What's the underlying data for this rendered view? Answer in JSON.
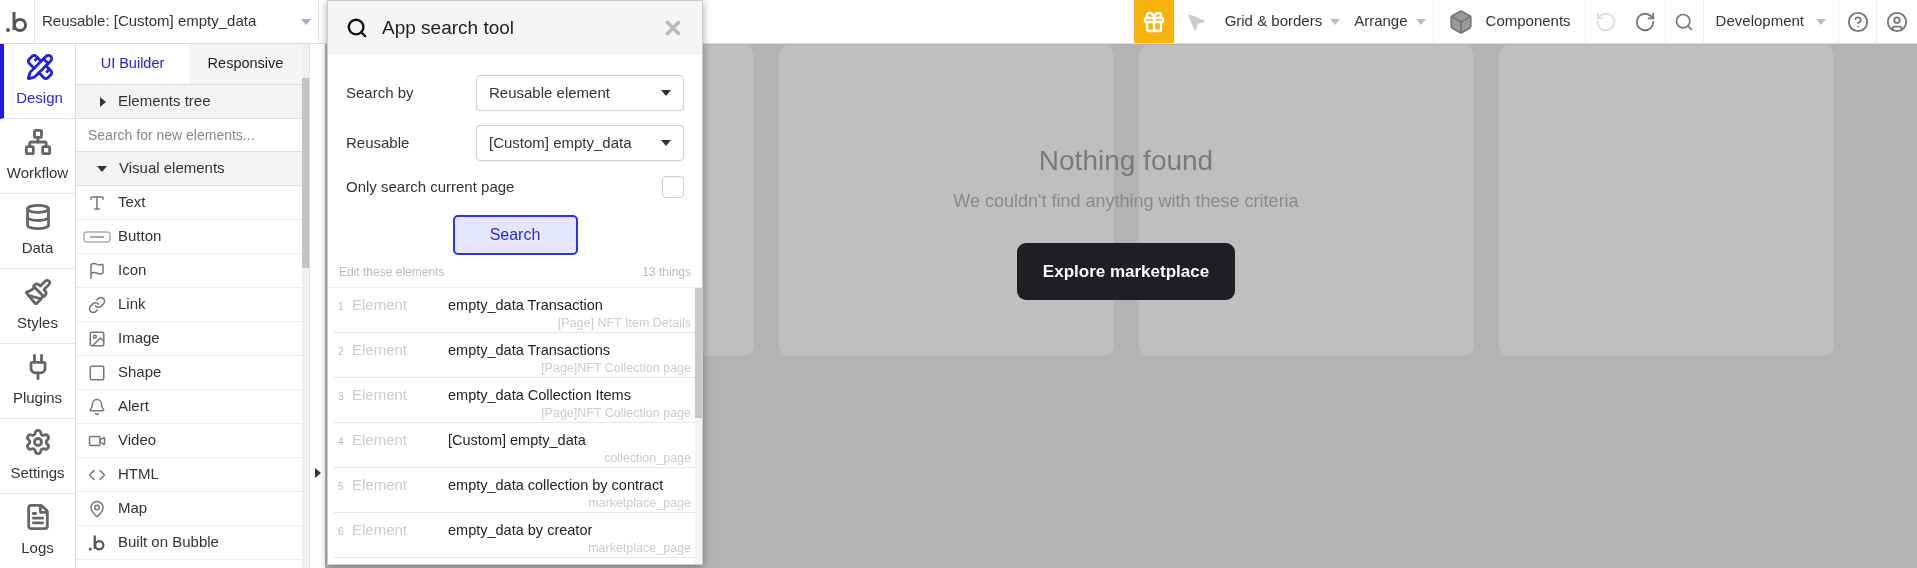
{
  "top_bar": {
    "page_selector": "Reusable: [Custom] empty_data",
    "menus": [
      {
        "label": "Grid & borders"
      },
      {
        "label": "Arrange"
      }
    ],
    "components": "Components",
    "undo": {
      "disabled": true
    },
    "redo": {
      "disabled": false
    },
    "environment": "Development"
  },
  "sidebar": {
    "items": [
      {
        "label": "Design",
        "kind": "design",
        "selected": true
      },
      {
        "label": "Workflow",
        "kind": "workflow",
        "selected": false
      },
      {
        "label": "Data",
        "kind": "data",
        "selected": false
      },
      {
        "label": "Styles",
        "kind": "styles",
        "selected": false
      },
      {
        "label": "Plugins",
        "kind": "plugins",
        "selected": false
      },
      {
        "label": "Settings",
        "kind": "settings",
        "selected": false
      },
      {
        "label": "Logs",
        "kind": "logs",
        "selected": false
      }
    ]
  },
  "panel": {
    "tabs": [
      {
        "label": "UI Builder",
        "selected": true
      },
      {
        "label": "Responsive",
        "selected": false
      }
    ],
    "elements_tree": {
      "label": "Elements tree",
      "expanded": false
    },
    "search": {
      "placeholder": "Search for new elements..."
    },
    "visual_elements": {
      "label": "Visual elements",
      "expanded": true,
      "items": [
        {
          "label": "Text",
          "kind": "text"
        },
        {
          "label": "Button",
          "kind": "button"
        },
        {
          "label": "Icon",
          "kind": "icon"
        },
        {
          "label": "Link",
          "kind": "link"
        },
        {
          "label": "Image",
          "kind": "image"
        },
        {
          "label": "Shape",
          "kind": "shape"
        },
        {
          "label": "Alert",
          "kind": "alert"
        },
        {
          "label": "Video",
          "kind": "video"
        },
        {
          "label": "HTML",
          "kind": "html"
        },
        {
          "label": "Map",
          "kind": "map"
        },
        {
          "label": "Built on Bubble",
          "kind": "bubble"
        }
      ]
    }
  },
  "search_tool": {
    "title": "App search tool",
    "search_by": {
      "label": "Search by",
      "value": "Reusable element"
    },
    "reusable": {
      "label": "Reusable",
      "value": "[Custom] empty_data"
    },
    "only_current_page": {
      "label": "Only search current page",
      "checked": false
    },
    "search_button": "Search",
    "results_heading": "Edit these elements",
    "results_count": "13 things",
    "results": [
      {
        "index": "1",
        "type": "Element",
        "name": "empty_data Transaction",
        "page": "[Page] NFT Item Details"
      },
      {
        "index": "2",
        "type": "Element",
        "name": "empty_data Transactions",
        "page": "[Page]NFT Collection page"
      },
      {
        "index": "3",
        "type": "Element",
        "name": "empty_data Collection Items",
        "page": "[Page]NFT Collection page"
      },
      {
        "index": "4",
        "type": "Element",
        "name": "[Custom] empty_data",
        "page": "collection_page"
      },
      {
        "index": "5",
        "type": "Element",
        "name": "empty_data collection by contract",
        "page": "marketplace_page"
      },
      {
        "index": "6",
        "type": "Element",
        "name": "empty_data by creator",
        "page": "marketplace_page"
      }
    ]
  },
  "canvas": {
    "empty_state": {
      "title": "Nothing found",
      "message": "We couldn't find anything with these criteria",
      "button": "Explore marketplace"
    }
  }
}
